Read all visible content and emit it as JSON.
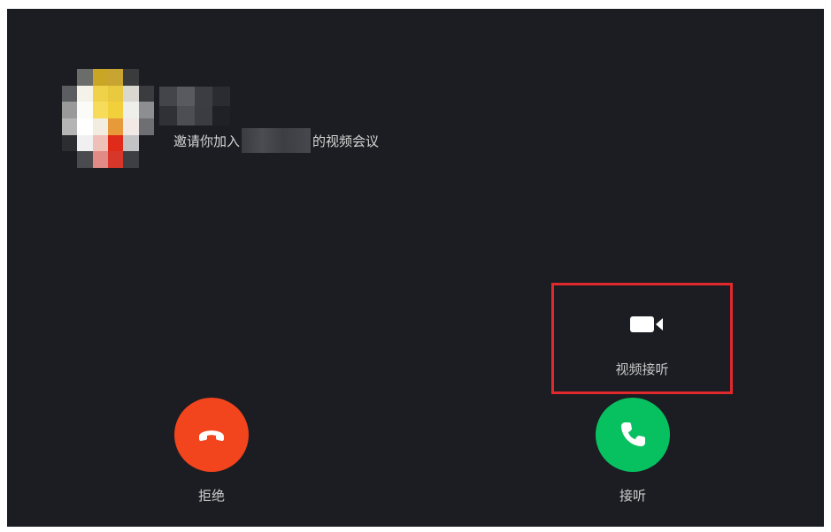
{
  "caller": {
    "invite_prefix": "邀请你加入",
    "invite_suffix": "的视频会议"
  },
  "video_answer": {
    "label": "视频接听",
    "icon": "video-camera-icon"
  },
  "decline": {
    "label": "拒绝",
    "icon": "phone-hangup-icon",
    "color": "#f2441d"
  },
  "accept": {
    "label": "接听",
    "icon": "phone-icon",
    "color": "#07c160"
  },
  "highlight_color": "#e0292d"
}
